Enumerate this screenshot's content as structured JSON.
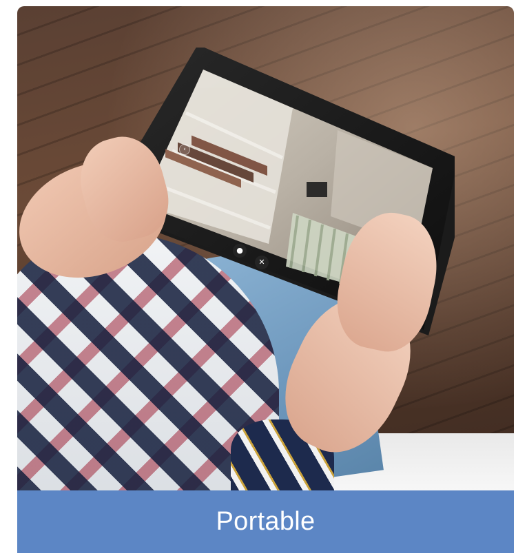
{
  "caption": {
    "label": "Portable",
    "background": "#5c86c5",
    "text_color": "#ffffff"
  },
  "photo": {
    "icons": [
      "back-icon",
      "mic-icon",
      "mute-icon",
      "capture-icon"
    ]
  }
}
